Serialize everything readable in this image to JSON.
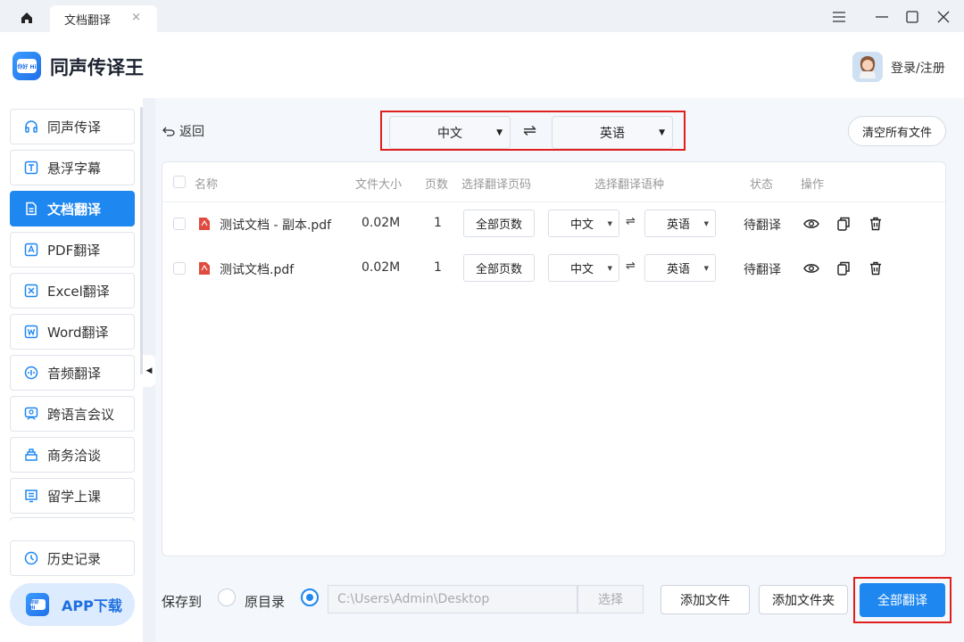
{
  "titlebar": {
    "tab_label": "文档翻译",
    "tab_close": "×",
    "icons": [
      "home-icon",
      "menu-icon",
      "minimize-icon",
      "maximize-icon",
      "close-icon"
    ]
  },
  "header": {
    "app_title": "同声传译王",
    "logo_text": "你好 Hi",
    "login_label": "登录/注册"
  },
  "sidebar": {
    "items": [
      {
        "label": "同声传译",
        "icon": "headphones-icon"
      },
      {
        "label": "悬浮字幕",
        "icon": "text-icon"
      },
      {
        "label": "文档翻译",
        "icon": "document-icon"
      },
      {
        "label": "PDF翻译",
        "icon": "pdf-icon"
      },
      {
        "label": "Excel翻译",
        "icon": "excel-icon"
      },
      {
        "label": "Word翻译",
        "icon": "word-icon"
      },
      {
        "label": "音频翻译",
        "icon": "audio-icon"
      },
      {
        "label": "跨语言会议",
        "icon": "meeting-icon"
      },
      {
        "label": "商务洽谈",
        "icon": "business-icon"
      },
      {
        "label": "留学上课",
        "icon": "class-icon"
      }
    ],
    "active_index": 2,
    "history_label": "历史记录",
    "app_download_label": "APP下载"
  },
  "toolbar": {
    "back_label": "返回",
    "source_lang": "中文",
    "target_lang": "英语",
    "swap_symbol": "⇌",
    "clear_label": "清空所有文件"
  },
  "table": {
    "headers": {
      "name": "名称",
      "size": "文件大小",
      "pages": "页数",
      "page_range": "选择翻译页码",
      "languages": "选择翻译语种",
      "status": "状态",
      "actions": "操作"
    },
    "rows": [
      {
        "name": "测试文档 - 副本.pdf",
        "size": "0.02M",
        "pages": "1",
        "page_btn": "全部页数",
        "src": "中文",
        "tgt": "英语",
        "status": "待翻译"
      },
      {
        "name": "测试文档.pdf",
        "size": "0.02M",
        "pages": "1",
        "page_btn": "全部页数",
        "src": "中文",
        "tgt": "英语",
        "status": "待翻译"
      }
    ]
  },
  "footer": {
    "save_to_label": "保存到",
    "option_original": "原目录",
    "path_value": "C:\\Users\\Admin\\Desktop",
    "choose_label": "选择",
    "add_file_label": "添加文件",
    "add_folder_label": "添加文件夹",
    "translate_all_label": "全部翻译"
  },
  "colors": {
    "accent": "#1e87f0",
    "highlight_box": "#e0201c",
    "pdf_icon": "#e04a3f"
  }
}
